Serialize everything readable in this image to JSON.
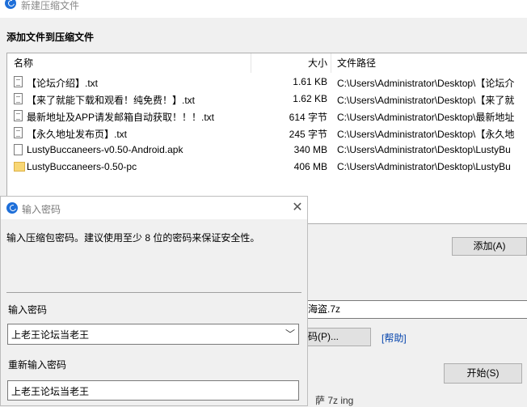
{
  "main_window": {
    "title": "新建压缩文件",
    "section_heading": "添加文件到压缩文件",
    "columns": {
      "name": "名称",
      "size": "大小",
      "path": "文件路径"
    },
    "files": [
      {
        "name": "【论坛介绍】.txt",
        "size": "1.61 KB",
        "path": "C:\\Users\\Administrator\\Desktop\\【论坛介",
        "icon": "text-file-icon"
      },
      {
        "name": "【来了就能下载和观看！纯免费！】.txt",
        "size": "1.62 KB",
        "path": "C:\\Users\\Administrator\\Desktop\\【来了就",
        "icon": "text-file-icon"
      },
      {
        "name": "最新地址及APP请发邮箱自动获取！！！.txt",
        "size": "614 字节",
        "path": "C:\\Users\\Administrator\\Desktop\\最新地址",
        "icon": "text-file-icon"
      },
      {
        "name": "【永久地址发布页】.txt",
        "size": "245 字节",
        "path": "C:\\Users\\Administrator\\Desktop\\【永久地",
        "icon": "text-file-icon"
      },
      {
        "name": "LustyBuccaneers-v0.50-Android.apk",
        "size": "340 MB",
        "path": "C:\\Users\\Administrator\\Desktop\\LustyBu",
        "icon": "file-icon"
      },
      {
        "name": "LustyBuccaneers-0.50-pc",
        "size": "406 MB",
        "path": "C:\\Users\\Administrator\\Desktop\\LustyBu",
        "icon": "folder-icon"
      }
    ],
    "add_label": "添加(A)",
    "archive_name": "的海盗.7z",
    "set_password_label": "密码(P)...",
    "help_label": "[帮助]",
    "start_label": "开始(S)",
    "bottom_partial": "萨 7z ing"
  },
  "password_dialog": {
    "title": "输入密码",
    "close_glyph": "✕",
    "description": "输入压缩包密码。建议使用至少 8 位的密码来保证安全性。",
    "password_label": "输入密码",
    "password_value": "上老王论坛当老王",
    "confirm_label": "重新输入密码",
    "confirm_value": "上老王论坛当老王",
    "dropdown_glyph": "﹀"
  },
  "colors": {
    "accent": "#1e6fd9",
    "link": "#0645ad",
    "folder": "#f8d775"
  }
}
